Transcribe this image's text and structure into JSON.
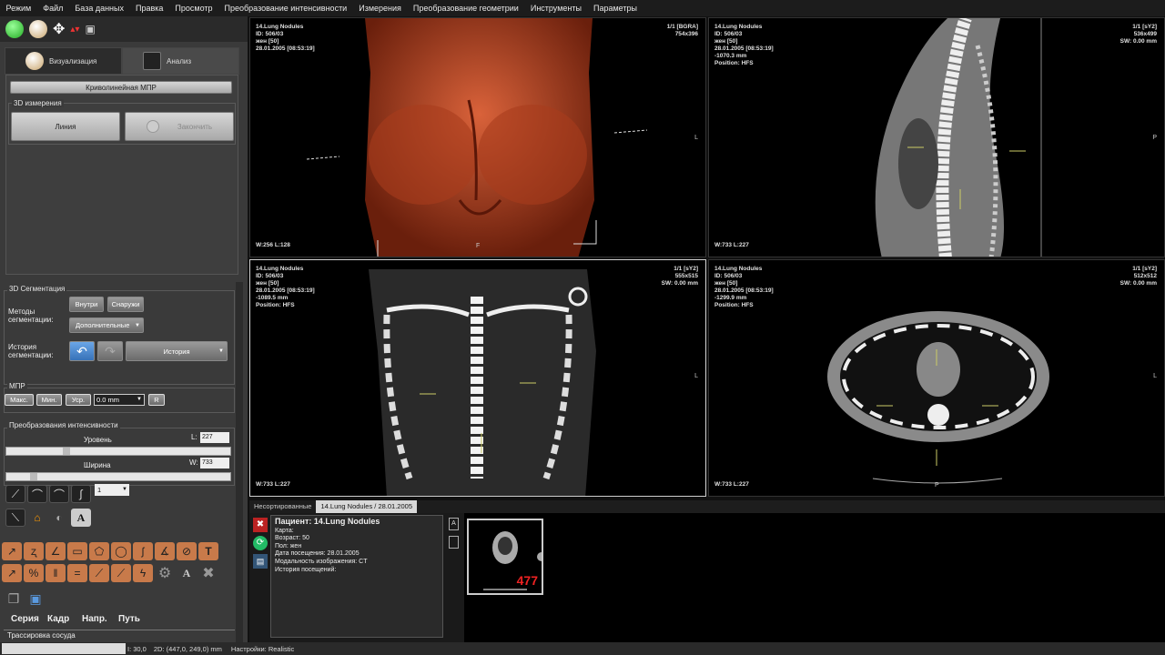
{
  "menu": [
    "Режим",
    "Файл",
    "База данных",
    "Правка",
    "Просмотр",
    "Преобразование интенсивности",
    "Измерения",
    "Преобразование геометрии",
    "Инструменты",
    "Параметры"
  ],
  "tabs": {
    "visual": "Визуализация",
    "analysis": "Анализ"
  },
  "curved_mpr": "Криволинейная МПР",
  "measure": {
    "title": "3D измерения",
    "line": "Линия",
    "finish": "Закончить"
  },
  "seg": {
    "title": "3D Сегментация",
    "methods_label": "Методы сегментации:",
    "inside": "Внутри",
    "outside": "Снаружи",
    "additional": "Дополнительные",
    "history_label": "История сегментации:",
    "history": "История"
  },
  "mpr": {
    "title": "МПР",
    "max": "Макс.",
    "min": "Мин.",
    "avg": "Уср.",
    "thickness": "0.0 mm",
    "reset": "R"
  },
  "intensity": {
    "title": "Преобразования интенсивности",
    "level_label": "Уровень",
    "level_key": "L:",
    "level": "227",
    "width_label": "Ширина",
    "width_key": "W:",
    "width": "733",
    "preset": "1"
  },
  "nav": {
    "series": "Серия",
    "frame": "Кадр",
    "dir": "Напр.",
    "path": "Путь"
  },
  "vessel": "Трассировка сосуда",
  "viewports": [
    {
      "info": "14.Lung Nodules\nID: 506/03\nжен [50]\n28.01.2005 [08:53:19]",
      "right": "1/1 [BGRA]\n754x396",
      "wl": "W:256 L:128",
      "ori_r": "L",
      "ori_b": "F"
    },
    {
      "info": "14.Lung Nodules\nID: 506/03\nжен [50]\n28.01.2005 [08:53:19]\n-1070.3 mm\nPosition: HFS",
      "right": "1/1 [sY2]\n536x499\nSW: 0.00 mm",
      "wl": "W:733 L:227",
      "ori_r": "P"
    },
    {
      "info": "14.Lung Nodules\nID: 506/03\nжен [50]\n28.01.2005 [08:53:19]\n-1089.5 mm\nPosition: HFS",
      "right": "1/1 [sY2]\n555x515\nSW: 0.00 mm",
      "wl": "W:733 L:227",
      "ori_r": "L"
    },
    {
      "info": "14.Lung Nodules\nID: 506/03\nжен [50]\n28.01.2005 [08:53:19]\n-1299.9 mm\nPosition: HFS",
      "right": "1/1 [sY2]\n512x512\nSW: 0.00 mm",
      "wl": "W:733 L:227",
      "ori_r": "L",
      "ori_b": "P"
    }
  ],
  "bottom_tabs": [
    "Несортированные",
    "14.Lung Nodules / 28.01.2005"
  ],
  "patient": {
    "title": "Пациент: 14.Lung Nodules",
    "card": "Карта:",
    "age": "Возраст: 50",
    "sex": "Пол: жен",
    "visit": "Дата посещения: 28.01.2005",
    "modality": "Модальность изображения: CT",
    "history": "История посещений:"
  },
  "thumb_count": "477",
  "thumb_flag": "A",
  "status": {
    "i": "I: 30,0",
    "coords": "2D: (447,0, 249,0) mm",
    "preset": "Настройки: Realistic"
  }
}
